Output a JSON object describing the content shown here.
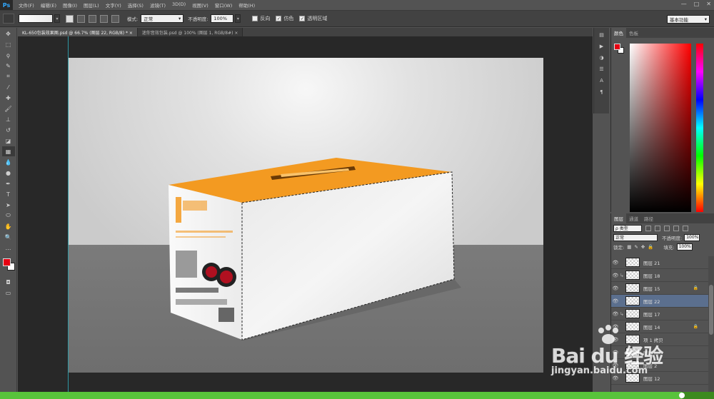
{
  "app": {
    "logo": "Ps"
  },
  "menu": [
    "文件(F)",
    "编辑(E)",
    "图像(I)",
    "图层(L)",
    "文字(Y)",
    "选择(S)",
    "滤镜(T)",
    "3D(D)",
    "视图(V)",
    "窗口(W)",
    "帮助(H)"
  ],
  "window_controls": {
    "minimize": "—",
    "restore": "□",
    "close": "✕"
  },
  "options": {
    "mode_label": "模式:",
    "mode_value": "正常",
    "opacity_label": "不透明度:",
    "opacity_value": "100%",
    "reverse_label": "反向",
    "dither_label": "仿色",
    "transparency_label": "透明区域",
    "workspace": "基本功能"
  },
  "doc_tabs": [
    {
      "label": "KL-650包装效果图.psd @ 66.7% (图层 22, RGB/8) *",
      "close": "×"
    },
    {
      "label": "迷你音效包装.psd @ 100% (图层 1, RGB/8#)",
      "close": "×"
    }
  ],
  "color_panel": {
    "tabs": [
      "颜色",
      "色板"
    ]
  },
  "layers_panel": {
    "tabs": [
      "图层",
      "通道",
      "路径"
    ],
    "filter_label": "ρ 类型",
    "blend_mode": "正常",
    "opacity_label": "不透明度:",
    "opacity_value": "100%",
    "lock_label": "锁定:",
    "fill_label": "填充:",
    "fill_value": "100%",
    "layers": [
      {
        "name": "图层 21",
        "clipped": false,
        "selected": false,
        "locked": false
      },
      {
        "name": "图层 18",
        "clipped": true,
        "selected": false,
        "locked": false
      },
      {
        "name": "图层 15",
        "clipped": false,
        "selected": false,
        "locked": true
      },
      {
        "name": "图层 22",
        "clipped": false,
        "selected": true,
        "locked": false
      },
      {
        "name": "图层 17",
        "clipped": true,
        "selected": false,
        "locked": false
      },
      {
        "name": "图层 14",
        "clipped": false,
        "selected": false,
        "locked": true
      },
      {
        "name": "项 1 拷贝",
        "clipped": false,
        "selected": false,
        "locked": false
      },
      {
        "name": "图层 ...",
        "clipped": false,
        "selected": false,
        "locked": false
      },
      {
        "name": "图层 2",
        "clipped": false,
        "selected": false,
        "locked": false
      },
      {
        "name": "图层 12",
        "clipped": false,
        "selected": false,
        "locked": false
      }
    ]
  },
  "playback": {
    "progress": 0.955
  },
  "watermark": {
    "brand": "Bai du 经验",
    "url": "jingyan.baidu.com"
  },
  "colors": {
    "foreground": "#e60012",
    "background": "#ffffff",
    "box_orange": "#f39a21",
    "selection_accent": "#5b6f8e"
  }
}
